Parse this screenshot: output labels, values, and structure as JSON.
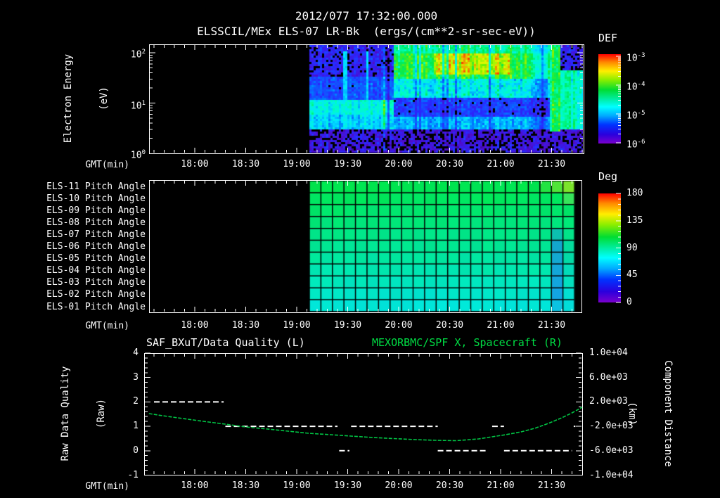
{
  "colors": {
    "background": "#000000",
    "foreground": "#ffffff",
    "accent_green": "#00dd44",
    "curve_green": "#00c444"
  },
  "title": "2012/077 17:32:00.000",
  "subtitle": "ELSSCIL/MEx ELS-07 LR-Bk  (ergs/(cm**2-sr-sec-eV))",
  "time_axis": {
    "label": "GMT(min)",
    "ticks": [
      "18:00",
      "18:30",
      "19:00",
      "19:30",
      "20:00",
      "20:30",
      "21:00",
      "21:30"
    ]
  },
  "spectrogram": {
    "ylabel1": "Electron Energy",
    "ylabel2": "(eV)",
    "yticks": [
      {
        "base": "10",
        "exp": "2"
      },
      {
        "base": "10",
        "exp": "1"
      },
      {
        "base": "10",
        "exp": "0"
      }
    ],
    "colorbar": {
      "title": "DEF",
      "ticks": [
        {
          "base": "10",
          "exp": "-3"
        },
        {
          "base": "10",
          "exp": "-4"
        },
        {
          "base": "10",
          "exp": "-5"
        },
        {
          "base": "10",
          "exp": "-6"
        }
      ]
    }
  },
  "pitch": {
    "row_labels": [
      "ELS-11 Pitch Angle",
      "ELS-10 Pitch Angle",
      "ELS-09 Pitch Angle",
      "ELS-08 Pitch Angle",
      "ELS-07 Pitch Angle",
      "ELS-06 Pitch Angle",
      "ELS-05 Pitch Angle",
      "ELS-04 Pitch Angle",
      "ELS-03 Pitch Angle",
      "ELS-02 Pitch Angle",
      "ELS-01 Pitch Angle"
    ],
    "colorbar": {
      "title": "Deg",
      "ticks": [
        "180",
        "135",
        "90",
        "45",
        "0"
      ]
    }
  },
  "quality": {
    "title_left": "SAF_BXuT/Data Quality (L)",
    "title_right": "MEXORBMC/SPF X, Spacecraft (R)",
    "ylabel_left1": "Raw Data Quality",
    "ylabel_left2": "(Raw)",
    "yticks_left": [
      "4",
      "3",
      "2",
      "1",
      "0",
      "-1"
    ],
    "ylabel_right1": "Component Distance",
    "ylabel_right2": "(km)",
    "yticks_right": [
      "1.0e+04",
      "6.0e+03",
      "2.0e+03",
      "-2.0e+03",
      "-6.0e+03",
      "-1.0e+04"
    ]
  },
  "chart_data": [
    {
      "type": "heatmap",
      "title": "2012/077 17:32:00.000",
      "subtitle": "ELSSCIL/MEx ELS-07 LR-Bk (ergs/(cm**2-sr-sec-eV))",
      "xlabel": "GMT(min)",
      "x_range": [
        "17:33",
        "21:49"
      ],
      "x_tick_labels": [
        "18:00",
        "18:30",
        "19:00",
        "19:30",
        "20:00",
        "20:30",
        "21:00",
        "21:30"
      ],
      "ylabel": "Electron Energy (eV)",
      "y_scale": "log",
      "y_range": [
        1,
        250
      ],
      "colorbar": {
        "title": "DEF",
        "scale": "log",
        "range": [
          1e-06,
          0.001
        ],
        "units": "ergs/(cm**2-sr-sec-eV)"
      },
      "data_coverage": {
        "start": "19:07",
        "end": "21:49"
      },
      "features": [
        {
          "time": "19:07-19:55",
          "energy_eV": "5-20",
          "flux": "~1e-5 bright cyan band"
        },
        {
          "time": "19:07-19:55",
          "energy_eV": "20-200",
          "flux": "~1e-6 blue/purple speckle"
        },
        {
          "time": "19:55-21:20",
          "energy_eV": "20-200",
          "flux": "~1e-4 bright green, yellow-green peaks ~2e-4 between 20:05-20:40"
        },
        {
          "time": "19:55-21:20",
          "energy_eV": "3-15",
          "flux": "~2e-6 blue with purple speckle"
        },
        {
          "time": "21:25-21:28",
          "energy_eV": "all",
          "flux": "bright green vertical streak"
        },
        {
          "time": "21:30-21:49",
          "energy_eV": "5-60",
          "flux": "~5e-5 green-cyan patch, dark purple above"
        },
        {
          "time": "19:07-21:49",
          "energy_eV": "1-3",
          "flux": "<1e-6 dark speckle"
        }
      ]
    },
    {
      "type": "heatmap",
      "rows": [
        {
          "label": "ELS-11 Pitch Angle",
          "approx_value_deg": 118
        },
        {
          "label": "ELS-10 Pitch Angle",
          "approx_value_deg": 115
        },
        {
          "label": "ELS-09 Pitch Angle",
          "approx_value_deg": 112
        },
        {
          "label": "ELS-08 Pitch Angle",
          "approx_value_deg": 110
        },
        {
          "label": "ELS-07 Pitch Angle",
          "approx_value_deg": 107
        },
        {
          "label": "ELS-06 Pitch Angle",
          "approx_value_deg": 104
        },
        {
          "label": "ELS-05 Pitch Angle",
          "approx_value_deg": 101
        },
        {
          "label": "ELS-04 Pitch Angle",
          "approx_value_deg": 98
        },
        {
          "label": "ELS-03 Pitch Angle",
          "approx_value_deg": 96
        },
        {
          "label": "ELS-02 Pitch Angle",
          "approx_value_deg": 94
        },
        {
          "label": "ELS-01 Pitch Angle",
          "approx_value_deg": 92
        }
      ],
      "colorbar": {
        "title": "Deg",
        "range": [
          0,
          180
        ],
        "ticks": [
          180,
          135,
          90,
          45,
          0
        ]
      },
      "data_coverage": {
        "start": "19:07",
        "end": "21:45"
      },
      "features": [
        {
          "time": "21:32-21:40",
          "rows": "ELS-01..ELS-06",
          "approx_value_deg": 55,
          "note": "blue vertical stripe"
        },
        {
          "time": "21:38-21:45",
          "rows": "ELS-11",
          "approx_value_deg": 140,
          "note": "yellow-green corner"
        }
      ]
    },
    {
      "type": "line",
      "xlabel": "GMT(min)",
      "x_tick_labels": [
        "18:00",
        "18:30",
        "19:00",
        "19:30",
        "20:00",
        "20:30",
        "21:00",
        "21:30"
      ],
      "ylabel_left": "Raw Data Quality (Raw)",
      "ylim_left": [
        -1,
        4
      ],
      "ylabel_right": "Component Distance (km)",
      "ylim_right": [
        -10000,
        10000
      ],
      "series": [
        {
          "name": "SAF_BXuT/Data Quality (L)",
          "axis": "left",
          "style": "white dashed step segments",
          "segments": [
            {
              "value": 2,
              "from": "17:36",
              "to": "18:17"
            },
            {
              "value": 1,
              "from": "18:18",
              "to": "19:24"
            },
            {
              "value": 0,
              "from": "19:25",
              "to": "19:31"
            },
            {
              "value": 1,
              "from": "19:32",
              "to": "20:23"
            },
            {
              "value": 0,
              "from": "20:23",
              "to": "20:52"
            },
            {
              "value": 1,
              "from": "20:55",
              "to": "21:02"
            },
            {
              "value": 0,
              "from": "21:02",
              "to": "21:42"
            },
            {
              "value": 1,
              "from": "21:43",
              "to": "21:44"
            }
          ]
        },
        {
          "name": "MEXORBMC/SPF X, Spacecraft (R)",
          "axis": "right",
          "color": "#00c444",
          "points": [
            [
              "17:33",
              90
            ],
            [
              "17:41",
              -260
            ],
            [
              "17:53",
              -720
            ],
            [
              "18:05",
              -1180
            ],
            [
              "18:18",
              -1640
            ],
            [
              "18:30",
              -2100
            ],
            [
              "18:43",
              -2450
            ],
            [
              "18:55",
              -2800
            ],
            [
              "19:07",
              -3140
            ],
            [
              "19:20",
              -3370
            ],
            [
              "19:32",
              -3600
            ],
            [
              "19:45",
              -3830
            ],
            [
              "19:57",
              -4010
            ],
            [
              "20:10",
              -4180
            ],
            [
              "20:22",
              -4290
            ],
            [
              "20:34",
              -4350
            ],
            [
              "20:47",
              -4060
            ],
            [
              "20:55",
              -3720
            ],
            [
              "21:03",
              -3370
            ],
            [
              "21:12",
              -2910
            ],
            [
              "21:20",
              -2330
            ],
            [
              "21:28",
              -1530
            ],
            [
              "21:36",
              -600
            ],
            [
              "21:42",
              200
            ],
            [
              "21:48",
              1120
            ]
          ]
        }
      ]
    }
  ]
}
